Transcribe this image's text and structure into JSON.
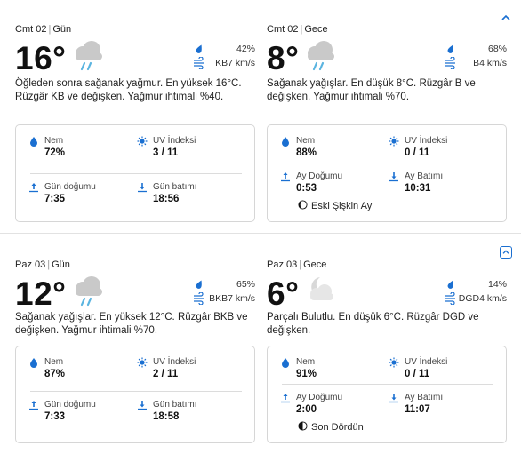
{
  "days": [
    {
      "day": {
        "label": "Cmt 02",
        "period": "Gün",
        "temp": "16°",
        "icon": "rain-cloud-icon",
        "humidity_pct": "42%",
        "wind": "KB7 km/s",
        "desc": "Öğleden sonra sağanak yağmur. En yüksek 16°C. Rüzgâr KB ve değişken. Yağmur ihtimali %40.",
        "card": {
          "humidity_label": "Nem",
          "humidity": "72%",
          "uv_label": "UV İndeksi",
          "uv": "3 / 11",
          "rise_label": "Gün doğumu",
          "rise": "7:35",
          "set_label": "Gün batımı",
          "set": "18:56"
        }
      },
      "night": {
        "label": "Cmt 02",
        "period": "Gece",
        "temp": "8°",
        "icon": "rain-cloud-icon",
        "humidity_pct": "68%",
        "wind": "B4 km/s",
        "desc": "Sağanak yağışlar. En düşük 8°C. Rüzgâr B ve değişken. Yağmur ihtimali %70.",
        "card": {
          "humidity_label": "Nem",
          "humidity": "88%",
          "uv_label": "UV İndeksi",
          "uv": "0 / 11",
          "rise_label": "Ay Doğumu",
          "rise": "0:53",
          "set_label": "Ay Batımı",
          "set": "10:31",
          "moon_phase": "Eski Şişkin Ay"
        }
      }
    },
    {
      "day": {
        "label": "Paz 03",
        "period": "Gün",
        "temp": "12°",
        "icon": "rain-cloud-icon",
        "humidity_pct": "65%",
        "wind": "BKB7 km/s",
        "desc": "Sağanak yağışlar. En yüksek 12°C. Rüzgâr BKB ve değişken. Yağmur ihtimali %70.",
        "card": {
          "humidity_label": "Nem",
          "humidity": "87%",
          "uv_label": "UV İndeksi",
          "uv": "2 / 11",
          "rise_label": "Gün doğumu",
          "rise": "7:33",
          "set_label": "Gün batımı",
          "set": "18:58"
        }
      },
      "night": {
        "label": "Paz 03",
        "period": "Gece",
        "temp": "6°",
        "icon": "moon-cloud-icon",
        "humidity_pct": "14%",
        "wind": "DGD4 km/s",
        "desc": "Parçalı Bulutlu. En düşük 6°C. Rüzgâr DGD ve değişken.",
        "card": {
          "humidity_label": "Nem",
          "humidity": "91%",
          "uv_label": "UV İndeksi",
          "uv": "0 / 11",
          "rise_label": "Ay Doğumu",
          "rise": "2:00",
          "set_label": "Ay Batımı",
          "set": "11:07",
          "moon_phase": "Son Dördün"
        }
      }
    }
  ],
  "colors": {
    "accent": "#1a6fd1",
    "card_border": "#d6d6d6",
    "divider": "#dcdcdc",
    "cloud": "#c9c9c9",
    "rain": "#5ab4e0"
  }
}
